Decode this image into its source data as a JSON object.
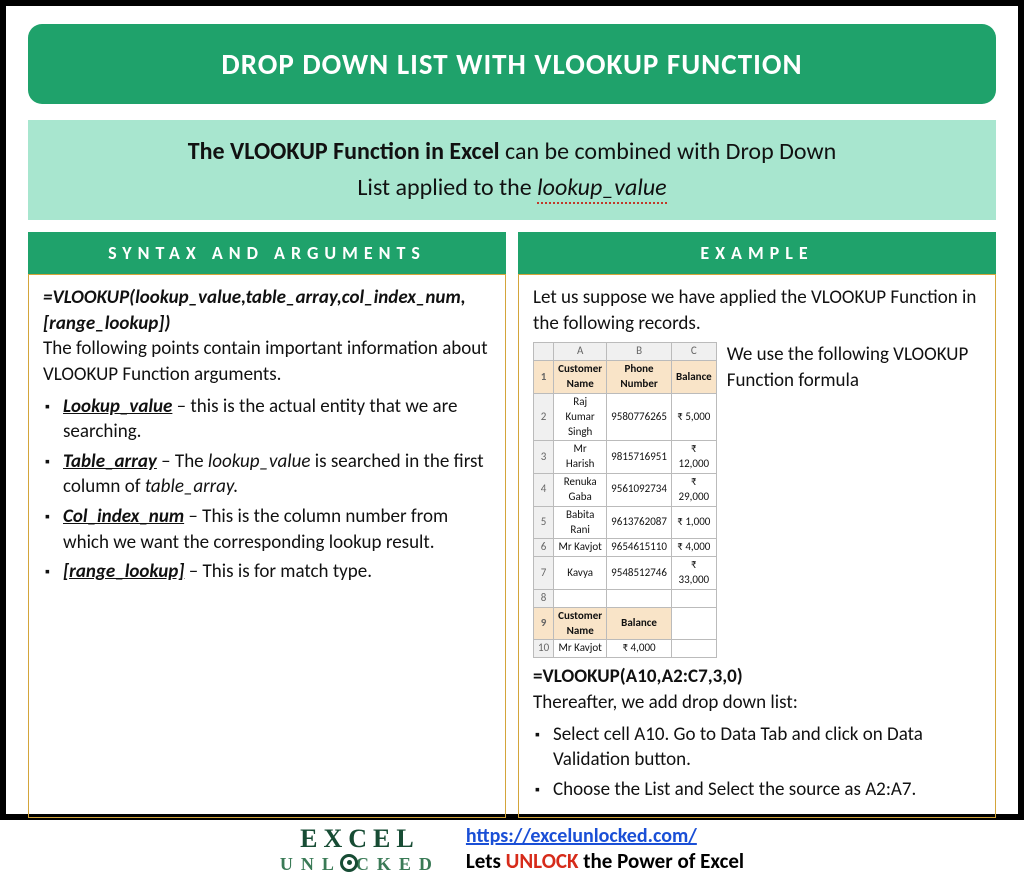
{
  "title": "DROP DOWN LIST WITH VLOOKUP FUNCTION",
  "intro": {
    "bold_part": "The VLOOKUP Function in Excel",
    "rest_line1": " can be combined with Drop Down",
    "line2_prefix": "List applied to the ",
    "lookup_word": "lookup_value"
  },
  "syntax": {
    "header": "SYNTAX AND ARGUMENTS",
    "formula": "=VLOOKUP(lookup_value,table_array,col_index_num,[range_lookup])",
    "lead": "The following points contain important information about VLOOKUP Function arguments.",
    "args": [
      {
        "name": "Lookup_value",
        "desc": " – this is the actual entity that we are searching."
      },
      {
        "name": "Table_array",
        "desc_pre": " – The ",
        "ital1": "lookup_value",
        "desc_mid": " is searched in the first column of ",
        "ital2": "table_array."
      },
      {
        "name": "Col_index_num",
        "desc": " – This is the column number from which we want the corresponding lookup result."
      },
      {
        "name": "[range_lookup]",
        "desc": " – This is for match type."
      }
    ]
  },
  "example": {
    "header": "EXAMPLE",
    "intro": "Let us suppose we have applied the VLOOKUP Function in the following records.",
    "table": {
      "colheads": [
        "",
        "A",
        "B",
        "C"
      ],
      "headers": [
        "Customer Name",
        "Phone Number",
        "Balance"
      ],
      "rows": [
        {
          "n": "2",
          "c": [
            "Raj Kumar Singh",
            "9580776265",
            "₹ 5,000"
          ]
        },
        {
          "n": "3",
          "c": [
            "Mr Harish",
            "9815716951",
            "₹ 12,000"
          ]
        },
        {
          "n": "4",
          "c": [
            "Renuka Gaba",
            "9561092734",
            "₹ 29,000"
          ]
        },
        {
          "n": "5",
          "c": [
            "Babita Rani",
            "9613762087",
            "₹ 1,000"
          ]
        },
        {
          "n": "6",
          "c": [
            "Mr Kavjot",
            "9654615110",
            "₹ 4,000"
          ]
        },
        {
          "n": "7",
          "c": [
            "Kavya",
            "9548512746",
            "₹ 33,000"
          ]
        }
      ],
      "lookup_header": [
        "Customer Name",
        "Balance"
      ],
      "lookup_row": {
        "n": "10",
        "c": [
          "Mr Kavjot",
          "₹ 4,000"
        ]
      }
    },
    "side_note": "We use the following VLOOKUP Function formula",
    "formula": "=VLOOKUP(A10,A2:C7,3,0)",
    "after": "Thereafter, we add drop down list:",
    "steps": [
      "Select cell A10. Go to Data Tab and click on Data Validation button.",
      "Choose the List and Select the source as A2:A7."
    ]
  },
  "footer": {
    "logo_top": "EXCEL",
    "logo_bottom": "UNL  CKED",
    "url": "https://excelunlocked.com/",
    "tag_pre": "Lets ",
    "tag_unlock": "UNLOCK",
    "tag_post": " the Power of Excel"
  }
}
